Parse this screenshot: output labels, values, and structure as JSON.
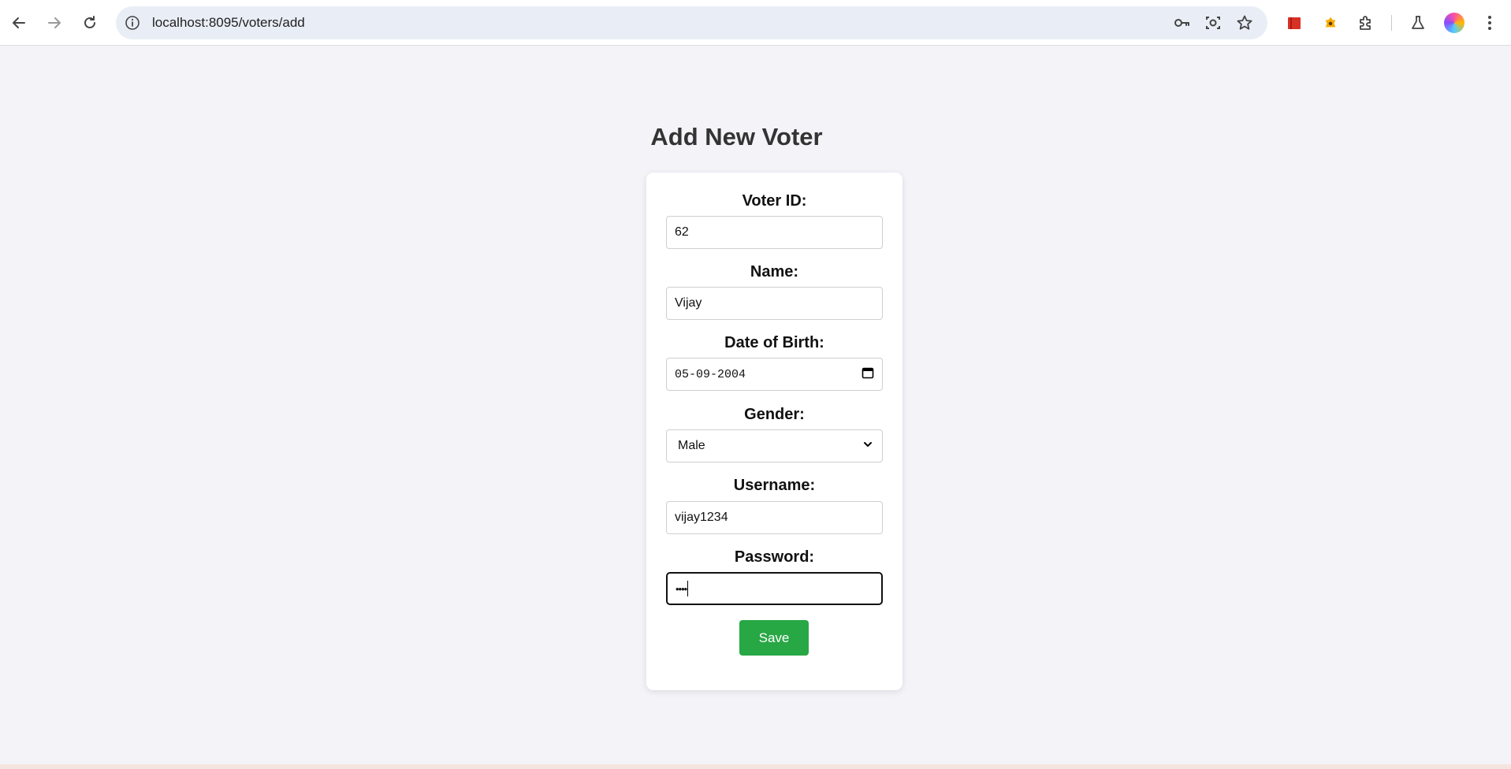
{
  "browser": {
    "url": "localhost:8095/voters/add",
    "icons": [
      "back-icon",
      "forward-icon",
      "reload-icon",
      "site-info-icon",
      "password-key-icon",
      "lens-icon",
      "bookmark-star-icon",
      "extension-red-icon",
      "extension-yellow-icon",
      "extensions-puzzle-icon",
      "labs-flask-icon",
      "profile-avatar",
      "more-menu-icon"
    ]
  },
  "page": {
    "title": "Add New Voter"
  },
  "form": {
    "voter_id": {
      "label": "Voter ID:",
      "value": "62"
    },
    "name": {
      "label": "Name:",
      "value": "Vijay"
    },
    "dob": {
      "label": "Date of Birth:",
      "value": "05-09-2004"
    },
    "gender": {
      "label": "Gender:",
      "value": "Male"
    },
    "username": {
      "label": "Username:",
      "value": "vijay1234"
    },
    "password": {
      "label": "Password:",
      "value": "••••"
    },
    "save_label": "Save"
  },
  "colors": {
    "page_bg": "#f3f3f8",
    "save_button": "#28a745",
    "title": "#333333"
  }
}
